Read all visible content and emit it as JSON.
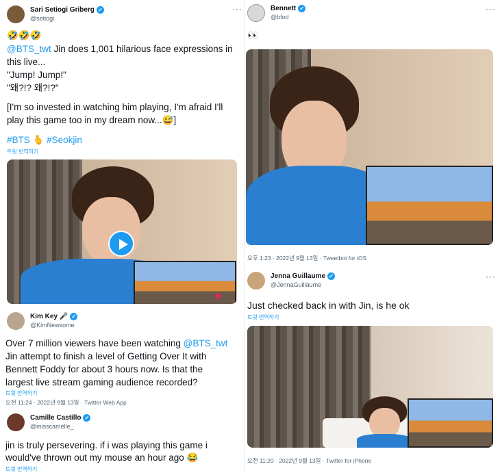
{
  "left": {
    "tweet1": {
      "name": "Sari Setiogi Griberg",
      "handle": "@setiogi",
      "emoji_line": "🤣🤣🤣",
      "mention": "@BTS_twt",
      "line1_rest": " Jin does 1,001 hilarious face expressions in",
      "line2": "this live...",
      "line3": "\"Jump! Jump!\"",
      "line4": "\"왜?!? 왜?!?\"",
      "line5": "[I'm so invested in watching him playing, I'm afraid I'll",
      "line6": "play this game too in my dream now...😅]",
      "hashtags": "#BTS 🫰 #Seokjin",
      "translate": "트윗 번역하기"
    },
    "tweet2": {
      "name": "Kim Key 🎤",
      "handle": "@KimNewsome",
      "line1_pre": "Over 7 million viewers have been watching ",
      "mention": "@BTS_twt",
      "line2": "Jin attempt to finish a level of Getting Over It with",
      "line3": "Bennett Foddy for about 3 hours now. Is that the",
      "line4": "largest live stream gaming audience recorded?",
      "translate": "트윗 번역하기",
      "meta": "오전 11:24 · 2022년 9월 13일 · Twitter Web App"
    },
    "tweet3": {
      "name": "Camille Castillo",
      "handle": "@misscamelle_",
      "line1": "jin is truly persevering. if i was playing this game i",
      "line2": "would've thrown out my mouse an hour ago 😂",
      "translate": "트윗 번역하기"
    }
  },
  "right": {
    "tweet1": {
      "name": "Bennett",
      "handle": "@bfod",
      "text": "👀",
      "meta": "오후 1:23 · 2022년 9월 13일 · Tweetbot for iOS"
    },
    "tweet2": {
      "name": "Jenna Guillaume",
      "handle": "@JennaGuillaume",
      "text": "Just checked back in with Jin, is he ok",
      "translate": "트윗 번역하기",
      "meta": "오전 11:20 · 2022년 9월 13일 · Twitter for iPhone"
    }
  },
  "ui": {
    "more": "···",
    "verified": "✓"
  },
  "colors": {
    "accent": "#1d9bf0",
    "text": "#0f1419",
    "muted": "#536471"
  }
}
